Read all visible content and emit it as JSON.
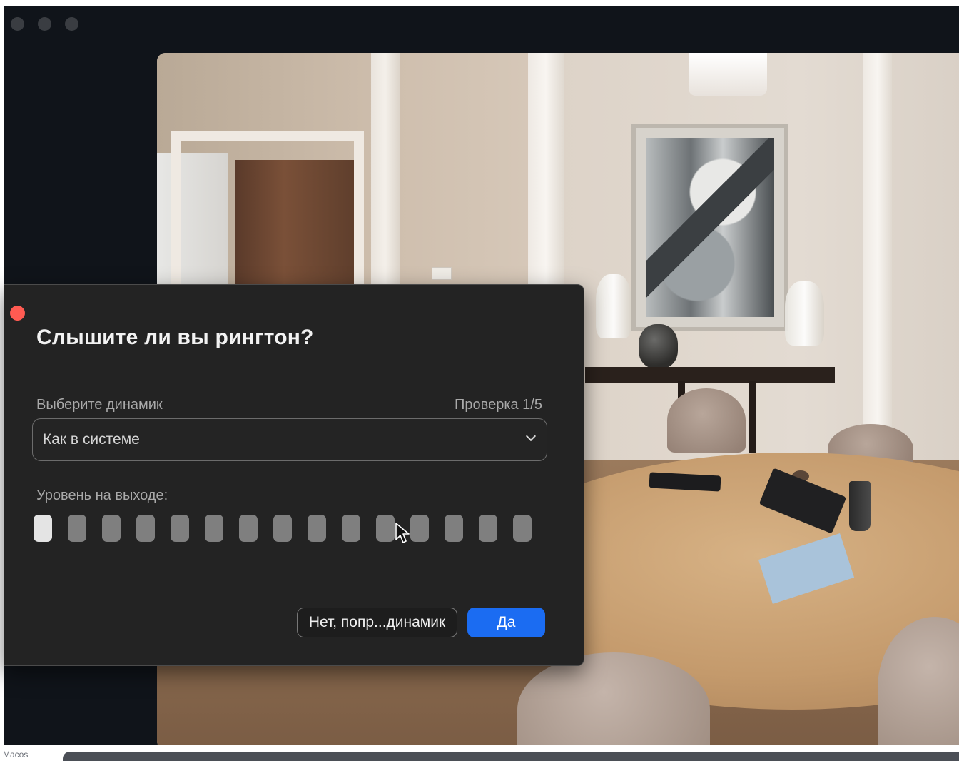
{
  "dialog": {
    "title": "Слышите ли вы рингтон?",
    "speaker_label": "Выберите динамик",
    "check_progress": "Проверка 1/5",
    "speaker_select": {
      "value": "Как в системе"
    },
    "output_level_label": "Уровень на выходе:",
    "output_level": {
      "segments_total": 15,
      "segments_lit": 1
    },
    "buttons": {
      "no_label": "Нет, попр...динамик",
      "yes_label": "Да"
    }
  },
  "footer": {
    "label": "Macos"
  },
  "colors": {
    "dialog_bg": "#232323",
    "accent_blue": "#1b6cf2",
    "close_red": "#ff5b52",
    "meter_lit": "#e4e4e4",
    "meter_unlit": "#7f7f7f"
  },
  "icons": [
    "close-dot",
    "chevron-down-icon",
    "mouse-cursor-icon"
  ]
}
